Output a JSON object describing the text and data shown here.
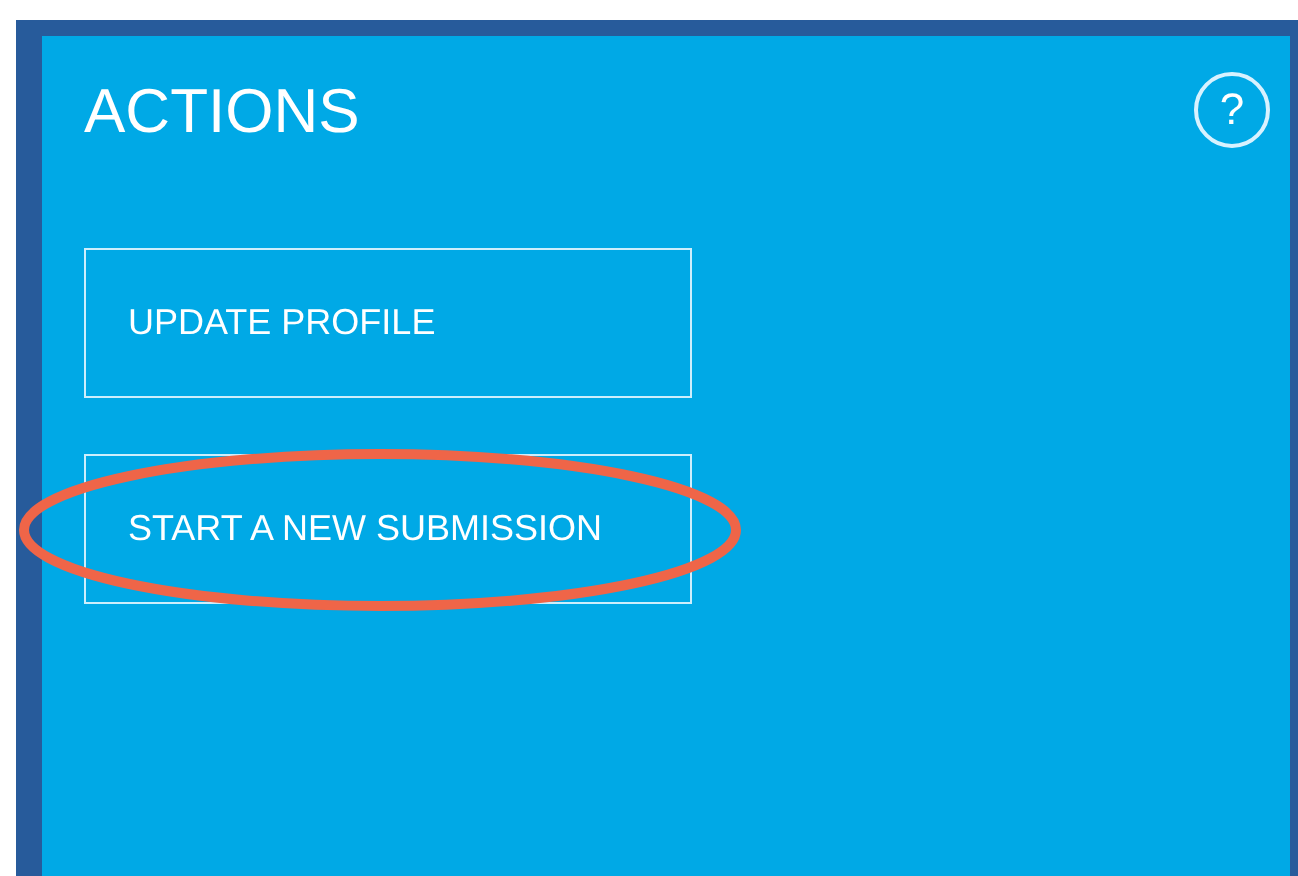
{
  "panel": {
    "title": "ACTIONS",
    "help": "?"
  },
  "buttons": [
    {
      "label": "UPDATE PROFILE",
      "circled": false
    },
    {
      "label": "START A NEW SUBMISSION",
      "circled": true
    }
  ]
}
